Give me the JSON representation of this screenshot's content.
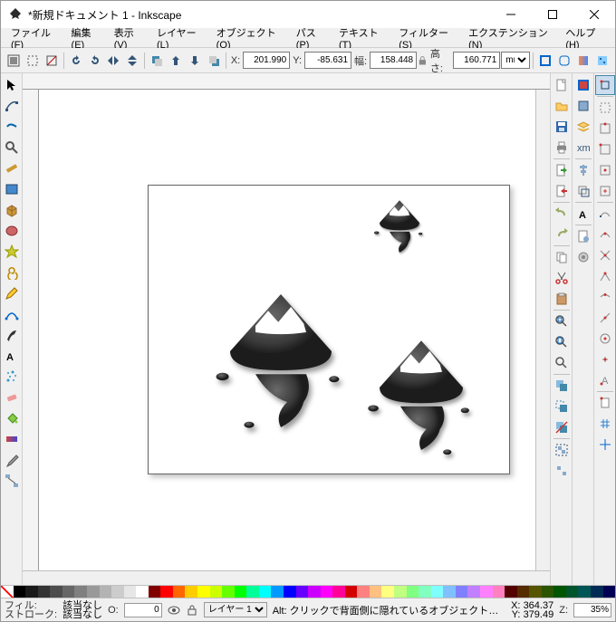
{
  "window": {
    "title": "*新規ドキュメント 1 - Inkscape"
  },
  "win_buttons": {
    "min": "–",
    "max": "☐",
    "close": "✕"
  },
  "menu": {
    "file": "ファイル(F)",
    "edit": "編集(E)",
    "view": "表示(V)",
    "layer": "レイヤー(L)",
    "object": "オブジェクト(O)",
    "path": "パス(P)",
    "text": "テキスト(T)",
    "filter": "フィルター(S)",
    "extension": "エクステンション(N)",
    "help": "ヘルプ(H)"
  },
  "toolbar": {
    "x_lbl": "X:",
    "x": "201.990",
    "y_lbl": "Y:",
    "y": "-85.631",
    "w_lbl": "幅:",
    "w": "158.448",
    "h_lbl": "高さ:",
    "h": "160.771",
    "unit": "mm"
  },
  "status": {
    "fill_lbl": "フィル:",
    "stroke_lbl": "ストローク:",
    "none": "該当なし",
    "opacity_lbl": "O:",
    "opacity": "0",
    "layer": "レイヤー 1",
    "hint": "Alt: クリックで背面側に隠れているオブジェクトを選択、マウススクロールで循環し…",
    "cx_lbl": "X:",
    "cx": "364.37",
    "cy_lbl": "Y:",
    "cy": "379.49",
    "z_lbl": "Z:",
    "zoom": "35%"
  },
  "palette": [
    "#000000",
    "#1a1a1a",
    "#333333",
    "#4d4d4d",
    "#666666",
    "#808080",
    "#999999",
    "#b3b3b3",
    "#cccccc",
    "#e6e6e6",
    "#ffffff",
    "#800000",
    "#ff0000",
    "#ff6600",
    "#ffcc00",
    "#ffff00",
    "#ccff00",
    "#66ff00",
    "#00ff00",
    "#00ff99",
    "#00ffff",
    "#0099ff",
    "#0000ff",
    "#6600ff",
    "#cc00ff",
    "#ff00ff",
    "#ff0099",
    "#d40000",
    "#ff8080",
    "#ffc080",
    "#ffff80",
    "#c0ff80",
    "#80ff80",
    "#80ffc0",
    "#80ffff",
    "#80c0ff",
    "#8080ff",
    "#c080ff",
    "#ff80ff",
    "#ff80c0",
    "#550000",
    "#552b00",
    "#555500",
    "#2b5500",
    "#005500",
    "#00552b",
    "#005555",
    "#002b55",
    "#000055"
  ]
}
